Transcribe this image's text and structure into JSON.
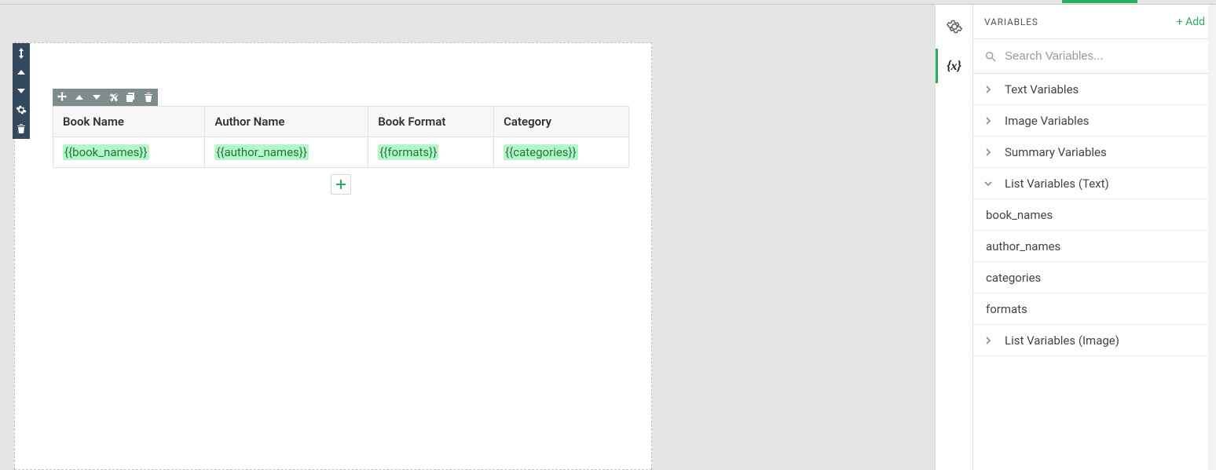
{
  "table": {
    "headers": [
      "Book Name",
      "Author Name",
      "Book Format",
      "Category"
    ],
    "row_vars": [
      "{{book_names}}",
      "{{author_names}}",
      "{{formats}}",
      "{{categories}}"
    ]
  },
  "right_panel": {
    "title": "VARIABLES",
    "add_label": "+ Add",
    "search_placeholder": "Search Variables...",
    "groups": [
      {
        "label": "Text Variables",
        "expanded": false
      },
      {
        "label": "Image Variables",
        "expanded": false
      },
      {
        "label": "Summary Variables",
        "expanded": false
      },
      {
        "label": "List Variables (Text)",
        "expanded": true,
        "items": [
          "book_names",
          "author_names",
          "categories",
          "formats"
        ]
      },
      {
        "label": "List Variables (Image)",
        "expanded": false
      }
    ]
  }
}
